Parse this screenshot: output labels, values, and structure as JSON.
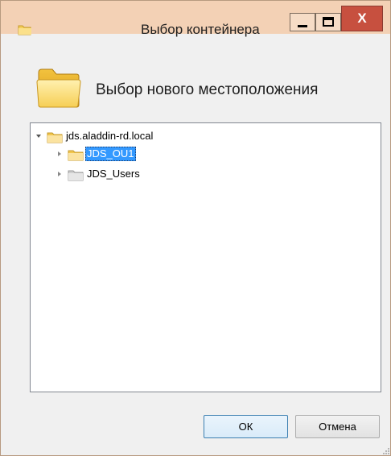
{
  "window": {
    "title": "Выбор контейнера",
    "colors": {
      "titlebar": "#f3d1b5",
      "close": "#c7503f",
      "selection": "#3399ff"
    },
    "controls": {
      "minimize_icon": "minimize-icon",
      "maximize_icon": "maximize-icon",
      "close_label": "X"
    }
  },
  "header": {
    "icon": "folder-icon",
    "text": "Выбор нового местоположения"
  },
  "tree": {
    "root": {
      "label": "jds.aladdin-rd.local",
      "expanded": true
    },
    "children": [
      {
        "label": "JDS_OU1",
        "selected": true,
        "icon": "ou-folder-icon"
      },
      {
        "label": "JDS_Users",
        "selected": false,
        "icon": "container-folder-icon"
      }
    ]
  },
  "buttons": {
    "ok": "ОК",
    "cancel": "Отмена"
  }
}
